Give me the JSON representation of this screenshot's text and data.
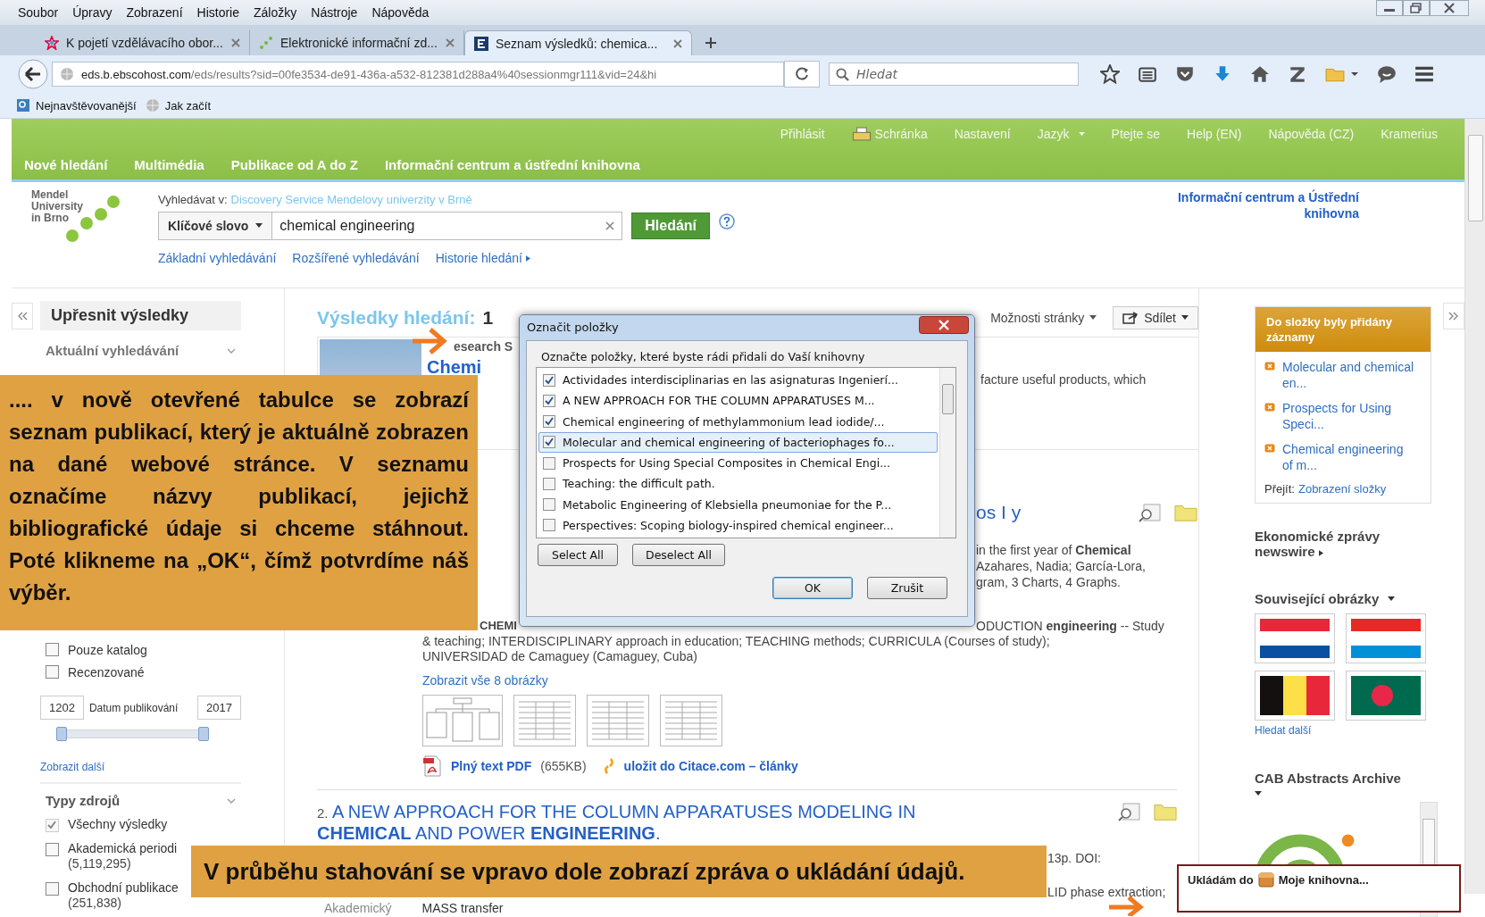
{
  "menu_bar": [
    "Soubor",
    "Úpravy",
    "Zobrazení",
    "Historie",
    "Záložky",
    "Nástroje",
    "Nápověda"
  ],
  "tabs": [
    {
      "title": "K pojetí vzdělávacího obor...",
      "kind": "star",
      "selected": false
    },
    {
      "title": "Elektronické informační zd...",
      "kind": "dots",
      "selected": false
    },
    {
      "title": "Seznam výsledků: chemica...",
      "kind": "letter",
      "selected": true
    }
  ],
  "address_bar": {
    "host": "eds.b.ebscohost.com",
    "path": "/eds/results?sid=00fe3534-de91-436a-a532-812381d288a4%40sessionmgr111&vid=24&hi"
  },
  "search_bar": {
    "placeholder": "Hledat"
  },
  "bookmarks": [
    "Nejnavštěvovanější",
    "Jak začít"
  ],
  "header": {
    "top_links": [
      {
        "label": "Přihlásit",
        "kind": "text"
      },
      {
        "label": "Schránka",
        "kind": "icon"
      },
      {
        "label": "Nastavení",
        "kind": "text"
      },
      {
        "label": "Jazyk",
        "kind": "menu"
      },
      {
        "label": "Ptejte se",
        "kind": "text"
      },
      {
        "label": "Help (EN)",
        "kind": "text"
      },
      {
        "label": "Nápověda (CZ)",
        "kind": "text"
      },
      {
        "label": "Kramerius",
        "kind": "text"
      }
    ],
    "nav": [
      "Nové hledání",
      "Multimédia",
      "Publikace od A do Z",
      "Informační centrum a ústřední knihovna"
    ]
  },
  "logo": [
    "Mendel",
    "University",
    "in Brno"
  ],
  "search": {
    "label": "Vyhledávat v:",
    "source": "Discovery Service Mendelovy univerzity v Brně",
    "field_type": "Klíčové slovo",
    "query": "chemical engineering",
    "button": "Hledání",
    "links": [
      "Základní vyhledávání",
      "Rozšířené vyhledávání",
      "Historie hledání"
    ]
  },
  "library_link": "Informační centrum a Ústřední knihovna",
  "sidebar": {
    "title": "Upřesnit výsledky",
    "current_search": "Aktuální vyhledávání",
    "limit_items": [
      {
        "label": "Pouze katalog",
        "checked": false
      },
      {
        "label": "Recenzované",
        "checked": false
      }
    ],
    "date": {
      "from": "1202",
      "label": "Datum publikování",
      "to": "2017"
    },
    "slider": {
      "level": 1
    },
    "show_more": "Zobrazit další",
    "source_types_title": "Typy zdrojů",
    "source_types": [
      {
        "label": "Všechny výsledky",
        "checked": true,
        "disabled": true
      },
      {
        "label": "Akademická periodi",
        "count": "(5,119,295)",
        "checked": false,
        "disabled": false
      },
      {
        "label": "Obchodní publikace",
        "count": "(251,838)",
        "checked": false,
        "disabled": false
      }
    ]
  },
  "results": {
    "heading": "Výsledky hledání:",
    "range": "1",
    "page_options": "Možnosti stránky",
    "share": "Sdílet",
    "starter": {
      "label": "esearch S",
      "title": "Chemi",
      "snippet": "facture useful products, which"
    },
    "result_1": {
      "title_tail": "os I y",
      "lines": [
        "in the first year of **Chemical**",
        "Azahares, Nadia; García-Lora,",
        "gram, 3 Charts, 4 Graphs."
      ],
      "subjects_start": "CHEMI",
      "subjects_end": "ODUCTION **engineering** -- Study",
      "subjects_more": [
        "& teaching; INTERDISCIPLINARY approach in education; TEACHING methods; CURRICULA (Courses of study);",
        "UNIVERSIDAD de Camaguey (Camaguey, Cuba)"
      ],
      "images_link": "Zobrazit vše 8 obrázky",
      "thumbnails": [
        {
          "kind": "diagram"
        },
        {
          "kind": "table"
        },
        {
          "kind": "table"
        },
        {
          "kind": "table"
        }
      ],
      "pdf_link": "Plný text PDF",
      "pdf_size": "(655KB)",
      "citace_link": "uložit do Citace.com – články"
    },
    "result_2": {
      "number": "2.",
      "title": "A NEW APPROACH FOR THE COLUMN APPARATUSES MODELING IN **CHEMICAL** AND POWER **ENGINEERING**.",
      "doi_tail": "13p. DOI:",
      "subjects_tail": "LID phase extraction;",
      "type": "Akademický",
      "subjects_more": "MASS transfer"
    }
  },
  "right_sidebar": {
    "folder_title": "Do složky byly přidány záznamy",
    "folder_items": [
      "Molecular and chemical en...",
      "Prospects for Using Speci...",
      "Chemical engineering of m..."
    ],
    "go_label": "Přejít:",
    "go_link": "Zobrazení složky",
    "news": "Ekonomické zprávy newswire",
    "images_title": "Související obrázky",
    "images": [
      {
        "kind": "bands-dark"
      },
      {
        "kind": "bands-light"
      },
      {
        "kind": "vertical-tricolor"
      },
      {
        "kind": "disc"
      }
    ],
    "more_images": "Hledat další",
    "cab_title": "CAB Abstracts Archive"
  },
  "dialog": {
    "title": "Označit položky",
    "instruction": "Označte položky, které byste rádi přidali do Vaší knihovny",
    "items": [
      {
        "label": "Actividades interdisciplinarias en las asignaturas Ingenierí...",
        "checked": true,
        "selected": false
      },
      {
        "label": "A NEW APPROACH FOR THE COLUMN APPARATUSES M...",
        "checked": true,
        "selected": false
      },
      {
        "label": "Chemical engineering of methylammonium lead iodide/...",
        "checked": true,
        "selected": false
      },
      {
        "label": "Molecular and chemical engineering of bacteriophages fo...",
        "checked": true,
        "selected": true
      },
      {
        "label": "Prospects for Using Special Composites in Chemical Engi...",
        "checked": false,
        "selected": false
      },
      {
        "label": "Teaching: the difficult path.",
        "checked": false,
        "selected": false
      },
      {
        "label": "Metabolic Engineering of Klebsiella pneumoniae for the P...",
        "checked": false,
        "selected": false
      },
      {
        "label": "Perspectives: Scoping biology-inspired chemical engineer...",
        "checked": false,
        "selected": false
      }
    ],
    "select_all": "Select All",
    "deselect_all": "Deselect All",
    "ok": "OK",
    "cancel": "Zrušit"
  },
  "notification": {
    "prefix": "Ukládám do",
    "target": "Moje knihovna..."
  },
  "annotations": [
    {
      "text": ".... v nově otevřené tabulce se zobrazí seznam publikací, který je aktuálně zobrazen na dané webové stránce. V seznamu označíme názvy publikací, jejichž bibliografické údaje si chceme stáhnout. Poté klikneme na „OK“, čímž potvrdíme náš výběr."
    },
    {
      "text": "V průběhu stahování se vpravo dole zobrazí zpráva o ukládání údajů."
    }
  ]
}
